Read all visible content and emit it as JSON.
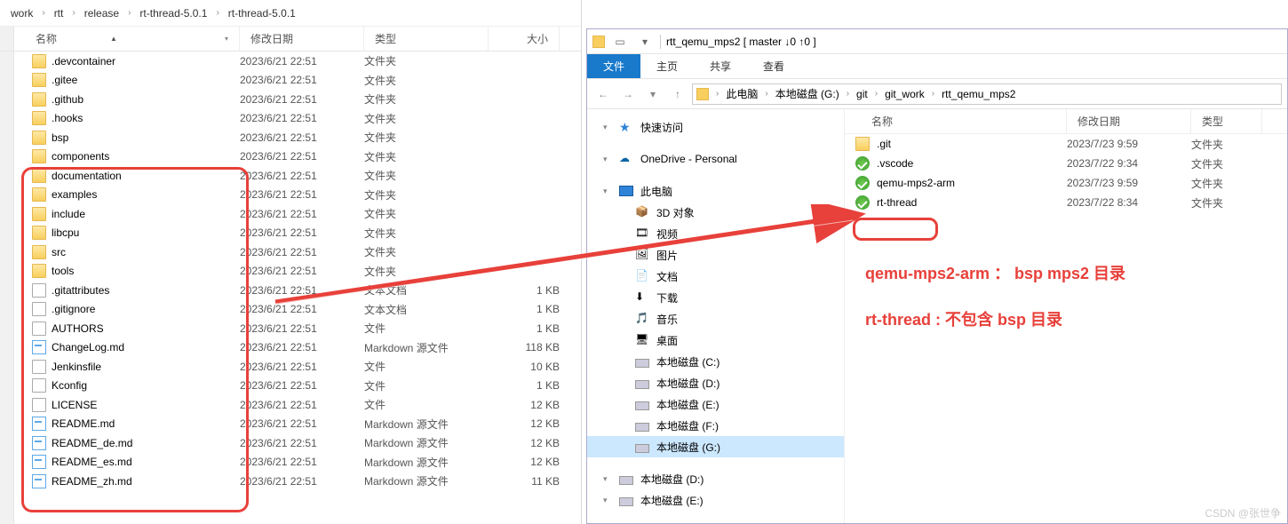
{
  "left": {
    "breadcrumb": [
      "work",
      "rtt",
      "release",
      "rt-thread-5.0.1",
      "rt-thread-5.0.1"
    ],
    "cols": {
      "name": "名称",
      "date": "修改日期",
      "type": "类型",
      "size": "大小"
    },
    "files": [
      {
        "i": "folder",
        "n": ".devcontainer",
        "d": "2023/6/21 22:51",
        "t": "文件夹",
        "s": ""
      },
      {
        "i": "folder",
        "n": ".gitee",
        "d": "2023/6/21 22:51",
        "t": "文件夹",
        "s": ""
      },
      {
        "i": "folder",
        "n": ".github",
        "d": "2023/6/21 22:51",
        "t": "文件夹",
        "s": ""
      },
      {
        "i": "folder",
        "n": ".hooks",
        "d": "2023/6/21 22:51",
        "t": "文件夹",
        "s": ""
      },
      {
        "i": "folder",
        "n": "bsp",
        "d": "2023/6/21 22:51",
        "t": "文件夹",
        "s": ""
      },
      {
        "i": "folder",
        "n": "components",
        "d": "2023/6/21 22:51",
        "t": "文件夹",
        "s": ""
      },
      {
        "i": "folder",
        "n": "documentation",
        "d": "2023/6/21 22:51",
        "t": "文件夹",
        "s": ""
      },
      {
        "i": "folder",
        "n": "examples",
        "d": "2023/6/21 22:51",
        "t": "文件夹",
        "s": ""
      },
      {
        "i": "folder",
        "n": "include",
        "d": "2023/6/21 22:51",
        "t": "文件夹",
        "s": ""
      },
      {
        "i": "folder",
        "n": "libcpu",
        "d": "2023/6/21 22:51",
        "t": "文件夹",
        "s": ""
      },
      {
        "i": "folder",
        "n": "src",
        "d": "2023/6/21 22:51",
        "t": "文件夹",
        "s": ""
      },
      {
        "i": "folder",
        "n": "tools",
        "d": "2023/6/21 22:51",
        "t": "文件夹",
        "s": ""
      },
      {
        "i": "file",
        "n": ".gitattributes",
        "d": "2023/6/21 22:51",
        "t": "文本文档",
        "s": "1 KB"
      },
      {
        "i": "file",
        "n": ".gitignore",
        "d": "2023/6/21 22:51",
        "t": "文本文档",
        "s": "1 KB"
      },
      {
        "i": "file",
        "n": "AUTHORS",
        "d": "2023/6/21 22:51",
        "t": "文件",
        "s": "1 KB"
      },
      {
        "i": "md",
        "n": "ChangeLog.md",
        "d": "2023/6/21 22:51",
        "t": "Markdown 源文件",
        "s": "118 KB"
      },
      {
        "i": "file",
        "n": "Jenkinsfile",
        "d": "2023/6/21 22:51",
        "t": "文件",
        "s": "10 KB"
      },
      {
        "i": "file",
        "n": "Kconfig",
        "d": "2023/6/21 22:51",
        "t": "文件",
        "s": "1 KB"
      },
      {
        "i": "file",
        "n": "LICENSE",
        "d": "2023/6/21 22:51",
        "t": "文件",
        "s": "12 KB"
      },
      {
        "i": "md",
        "n": "README.md",
        "d": "2023/6/21 22:51",
        "t": "Markdown 源文件",
        "s": "12 KB"
      },
      {
        "i": "md",
        "n": "README_de.md",
        "d": "2023/6/21 22:51",
        "t": "Markdown 源文件",
        "s": "12 KB"
      },
      {
        "i": "md",
        "n": "README_es.md",
        "d": "2023/6/21 22:51",
        "t": "Markdown 源文件",
        "s": "12 KB"
      },
      {
        "i": "md",
        "n": "README_zh.md",
        "d": "2023/6/21 22:51",
        "t": "Markdown 源文件",
        "s": "11 KB"
      }
    ]
  },
  "right": {
    "title": "rtt_qemu_mps2 [ master ↓0 ↑0 ]",
    "tabs": {
      "file": "文件",
      "home": "主页",
      "share": "共享",
      "view": "查看"
    },
    "addr": [
      "此电脑",
      "本地磁盘 (G:)",
      "git",
      "git_work",
      "rtt_qemu_mps2"
    ],
    "cols": {
      "name": "名称",
      "date": "修改日期",
      "type": "类型"
    },
    "nav": {
      "quick": "快速访问",
      "onedrive": "OneDrive - Personal",
      "pc": "此电脑",
      "pc_items": [
        "3D 对象",
        "视频",
        "图片",
        "文档",
        "下载",
        "音乐",
        "桌面",
        "本地磁盘 (C:)",
        "本地磁盘 (D:)",
        "本地磁盘 (E:)",
        "本地磁盘 (F:)",
        "本地磁盘 (G:)"
      ],
      "extra": [
        "本地磁盘 (D:)",
        "本地磁盘 (E:)"
      ]
    },
    "files": [
      {
        "i": "folder",
        "n": ".git",
        "d": "2023/7/23 9:59",
        "t": "文件夹"
      },
      {
        "i": "green",
        "n": ".vscode",
        "d": "2023/7/22 9:34",
        "t": "文件夹"
      },
      {
        "i": "green",
        "n": "qemu-mps2-arm",
        "d": "2023/7/23 9:59",
        "t": "文件夹"
      },
      {
        "i": "green",
        "n": "rt-thread",
        "d": "2023/7/22 8:34",
        "t": "文件夹"
      }
    ]
  },
  "annot": {
    "a1": "qemu-mps2-arm ：  bsp mps2 目录",
    "a2": "rt-thread : 不包含 bsp 目录"
  },
  "watermark": "CSDN @张世争"
}
